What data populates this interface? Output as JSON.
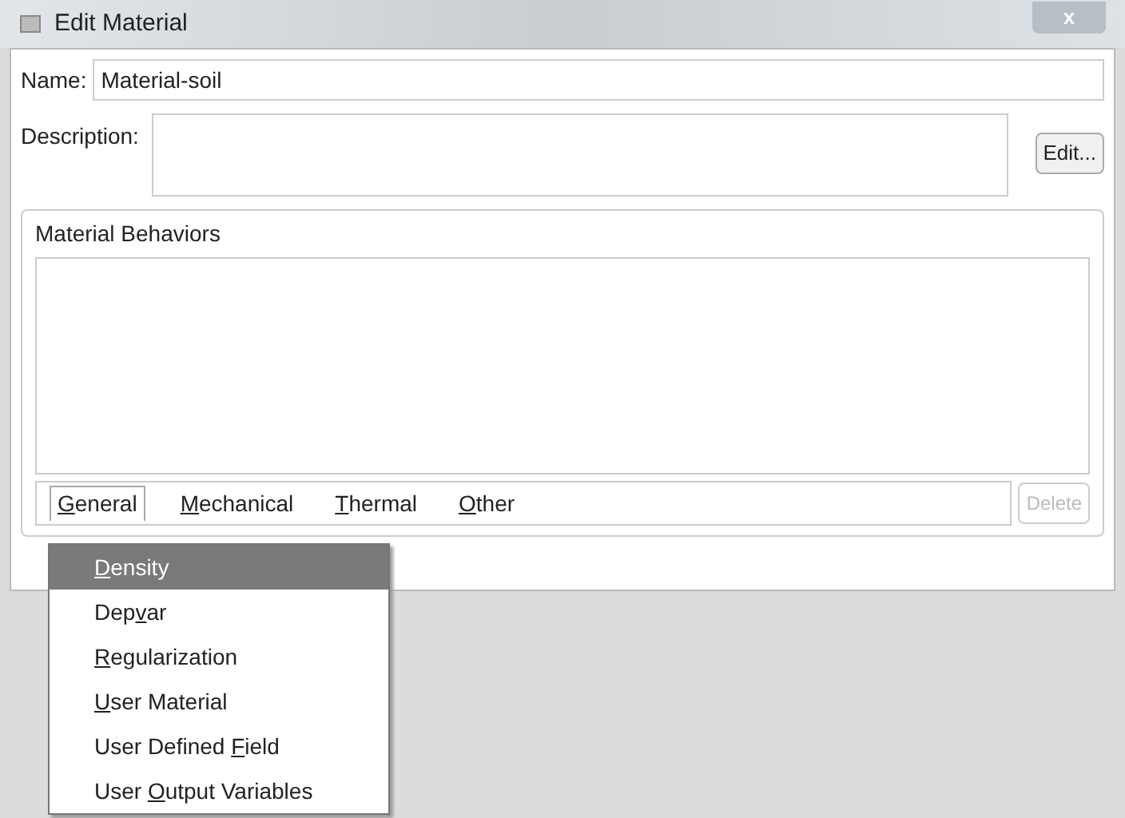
{
  "window": {
    "title": "Edit Material",
    "close": "x"
  },
  "name": {
    "label": "Name:",
    "value": "Material-soil"
  },
  "description": {
    "label": "Description:",
    "button": "Edit..."
  },
  "behaviors": {
    "title": "Material Behaviors"
  },
  "menu_bar": [
    {
      "key": "G",
      "post": "eneral",
      "selected": true
    },
    {
      "key": "M",
      "post": "echanical",
      "selected": false
    },
    {
      "key": "T",
      "post": "hermal",
      "selected": false
    },
    {
      "key": "O",
      "post": "ther",
      "selected": false
    }
  ],
  "delete_button": {
    "label": "Delete",
    "disabled": true
  },
  "dropdown": [
    {
      "key": "D",
      "post": "ensity",
      "selected": true
    },
    {
      "pre": "Dep",
      "key": "v",
      "post": "ar",
      "selected": false
    },
    {
      "key": "R",
      "post": "egularization",
      "selected": false
    },
    {
      "key": "U",
      "post": "ser Material",
      "selected": false
    },
    {
      "pre": "User Defined ",
      "key": "F",
      "post": "ield",
      "selected": false
    },
    {
      "pre": "User ",
      "key": "O",
      "post": "utput Variables",
      "selected": false
    }
  ]
}
